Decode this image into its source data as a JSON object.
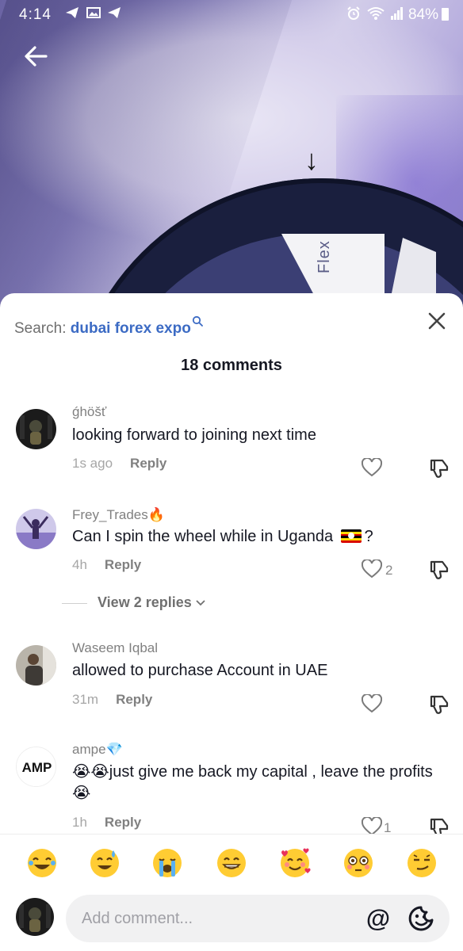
{
  "status_bar": {
    "time": "4:14",
    "left_icons": [
      "telegram-icon",
      "gallery-icon",
      "telegram-icon"
    ],
    "right_icons": [
      "alarm-icon",
      "wifi-icon",
      "signal-icon"
    ],
    "battery": "84%"
  },
  "video": {
    "wheel_label": "Flex"
  },
  "sheet": {
    "search_prefix": "Search:",
    "search_query": "dubai forex expo",
    "comment_count": "18 comments",
    "close_icon": "close-icon"
  },
  "comments": [
    {
      "username": "ǵhöšť",
      "text": "looking forward to joining next time",
      "time": "1s ago",
      "reply": "Reply",
      "likes": ""
    },
    {
      "username": "Frey_Trades",
      "username_emoji": "🔥",
      "text_before_flag": "Can I spin the wheel while in Uganda",
      "text_after_flag": "?",
      "time": "4h",
      "reply": "Reply",
      "likes": "2",
      "view_replies": "View 2 replies"
    },
    {
      "username": "Waseem Iqbal",
      "text": "allowed to purchase Account in UAE",
      "time": "31m",
      "reply": "Reply",
      "likes": ""
    },
    {
      "username": "ampe",
      "username_emoji": "💎",
      "avatar_text": "AMP",
      "text_lead_emoji": "😭😭",
      "text": "just give me back my capital , leave the profits",
      "text_trail_emoji": "😭",
      "time": "1h",
      "reply": "Reply",
      "likes": "1"
    }
  ],
  "quick_emojis": [
    "😂",
    "😅",
    "😭",
    "😁",
    "🥰",
    "😳",
    "😏"
  ],
  "input": {
    "placeholder": "Add comment...",
    "at_symbol": "@"
  },
  "colors": {
    "search_query": "#3c6bc4",
    "text_primary": "#161823",
    "text_secondary": "#808080",
    "input_bg": "#f1f1f2"
  }
}
